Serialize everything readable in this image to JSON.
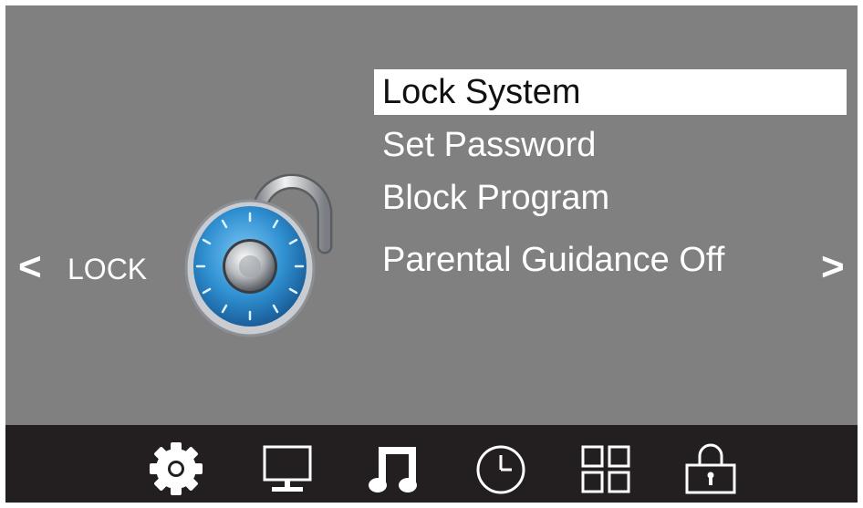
{
  "section": {
    "label": "LOCK",
    "prev_arrow": "<",
    "next_arrow": ">"
  },
  "menu": {
    "items": [
      {
        "label": "Lock System",
        "selected": true
      },
      {
        "label": "Set Password",
        "selected": false
      },
      {
        "label": "Block Program",
        "selected": false
      },
      {
        "label": "Parental Guidance Off",
        "selected": false
      }
    ]
  },
  "bottom_tabs": [
    {
      "icon": "gear-icon"
    },
    {
      "icon": "monitor-icon"
    },
    {
      "icon": "music-note-icon"
    },
    {
      "icon": "clock-icon"
    },
    {
      "icon": "grid-icon"
    },
    {
      "icon": "lock-icon"
    }
  ],
  "colors": {
    "background": "#808080",
    "bottom_bar": "#231f20",
    "selected_bg": "#ffffff",
    "text": "#ffffff",
    "lock_dial": "#2f8fd0"
  }
}
